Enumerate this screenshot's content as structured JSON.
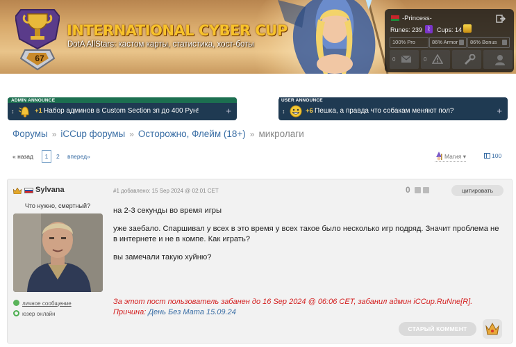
{
  "banner": {
    "title": "INTERNATIONAL CYBER CUP",
    "subtitle": "DotA AllStars: кастом карты, статистика, хост-боты",
    "trophy_level": "67"
  },
  "user_panel": {
    "username": "-Princess-",
    "runes_label": "Runes: 239",
    "rune_symbol": "ᚱ",
    "cups_label": "Cups: 14",
    "stats": [
      "100% Pro",
      "86% Armor",
      "86% Bonus"
    ],
    "messages_count": "0",
    "alerts_count": "0",
    "accent": "#7a35c9"
  },
  "announces": {
    "admin": {
      "tag": "ADMIN ANNOUNCE",
      "votes": "+1",
      "text": "Набор админов в Custom Section зп до 400 Рун!",
      "color": "#1c6f50"
    },
    "user": {
      "tag": "USER ANNOUNCE",
      "votes": "+6",
      "text": "Пешка, а правда что собакам меняют пол?",
      "color": "#1f3a52"
    }
  },
  "breadcrumbs": [
    "Форумы",
    "iCCup форумы",
    "Осторожно, Флейм (18+)",
    "микролаги"
  ],
  "pagination": {
    "back": "« назад",
    "pages": [
      "1",
      "2"
    ],
    "current": "1",
    "forward": "вперед»"
  },
  "toolbar": {
    "magic_label": "Магия ▾",
    "per_page": "100"
  },
  "post": {
    "author": "Sylvana",
    "status_quote": "Что нужно, смертный?",
    "pm_label": "личное сообщение",
    "online_label": "юзер онлайн",
    "meta": "#1 добавлено: 15 Sep 2024 @ 02:01 CET",
    "score": "0",
    "quote_button": "цитировать",
    "paragraphs": [
      "на 2-3 секунды во время игры",
      "уже заебало. Спаршивал у всех в это время у всех такое было несколько игр подряд. Значит проблема не в интернете и не в компе. Как играть?",
      "вы замечали такую хуйню?"
    ],
    "ban_line": "За этот пост пользователь забанен до 16 Sep 2024 @ 06:06 CET, забанил админ iCCup.RuNne[R].",
    "reason_label": "Причина:",
    "reason_text": "День Без Мата 15.09.24",
    "old_comment_button": "СТАРЫЙ КОММЕНТ"
  }
}
